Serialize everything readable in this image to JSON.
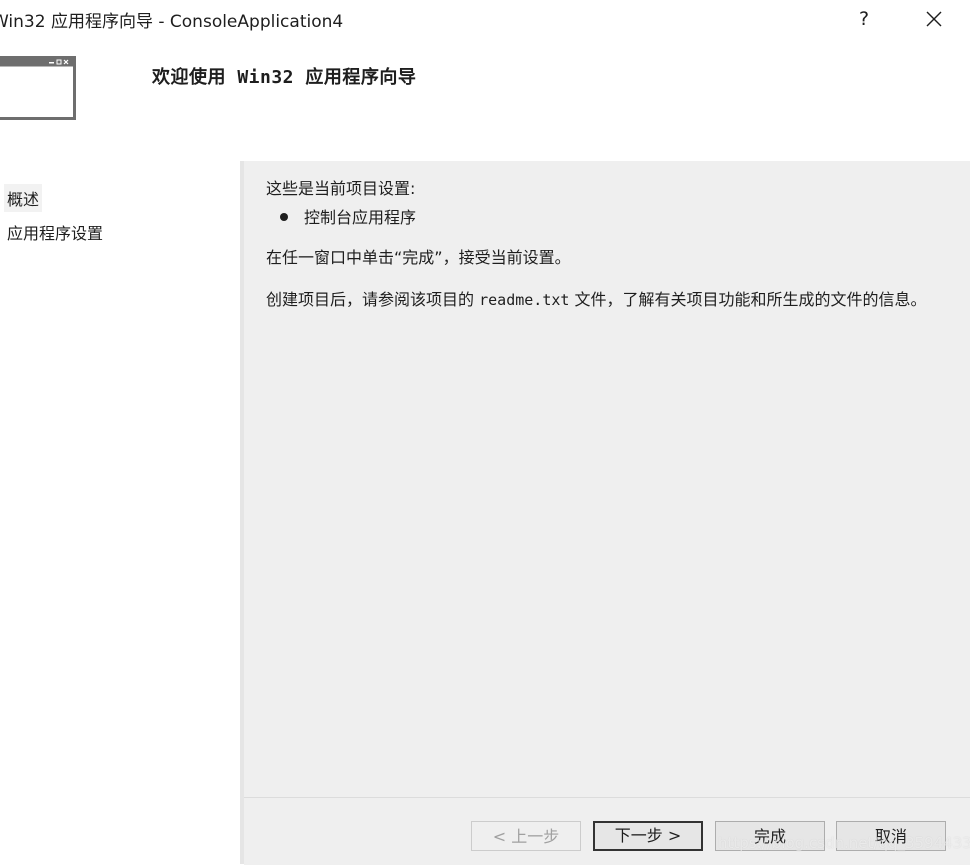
{
  "window": {
    "title": "Win32 应用程序向导 - ConsoleApplication4",
    "help_label": "?",
    "close_icon": "close-icon"
  },
  "header": {
    "logo_icon": "window-icon",
    "title": "欢迎使用 Win32 应用程序向导"
  },
  "sidebar": {
    "items": [
      {
        "label": "概述",
        "active": true
      },
      {
        "label": "应用程序设置",
        "active": false
      }
    ]
  },
  "content": {
    "settings_heading": "这些是当前项目设置:",
    "settings_items": [
      "控制台应用程序"
    ],
    "finish_hint": "在任一窗口中单击“完成”，接受当前设置。",
    "readme_prefix": "创建项目后，请参阅该项目的",
    "readme_file": "readme.txt",
    "readme_suffix": "文件，了解有关项目功能和所生成的文件的信息。"
  },
  "footer": {
    "prev_label": "< 上一步",
    "next_label": "下一步 >",
    "finish_label": "完成",
    "cancel_label": "取消"
  },
  "watermark": "https://blog.csdn.net/qq_35944331",
  "colors": {
    "content_bg": "#efefef",
    "button_bg": "#e6e6e6",
    "text": "#1e1e1e"
  }
}
